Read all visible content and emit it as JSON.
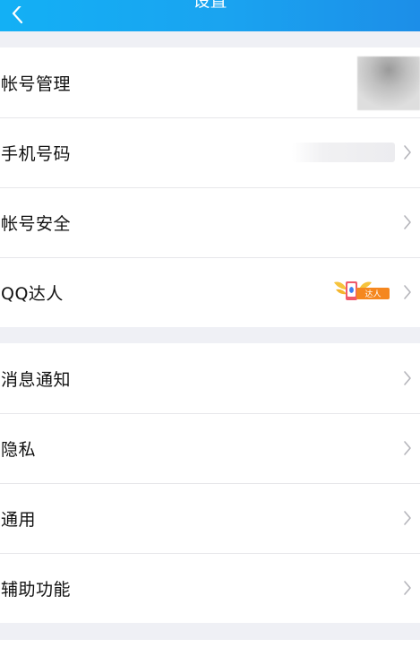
{
  "header": {
    "title": "设置"
  },
  "groups": {
    "account": {
      "account_mgmt": "帐号管理",
      "phone": "手机号码",
      "security": "帐号安全",
      "qq_daren": "QQ达人",
      "qq_daren_badge": "达人"
    },
    "general": {
      "notifications": "消息通知",
      "privacy": "隐私",
      "general": "通用",
      "accessibility": "辅助功能"
    }
  },
  "partial_bottom_label": "",
  "colors": {
    "header_start": "#13b0f5",
    "header_end": "#1c8ee8",
    "background": "#eff0f5"
  },
  "icons": {
    "back": "back-arrow-icon",
    "chevron": "chevron-right-icon"
  }
}
